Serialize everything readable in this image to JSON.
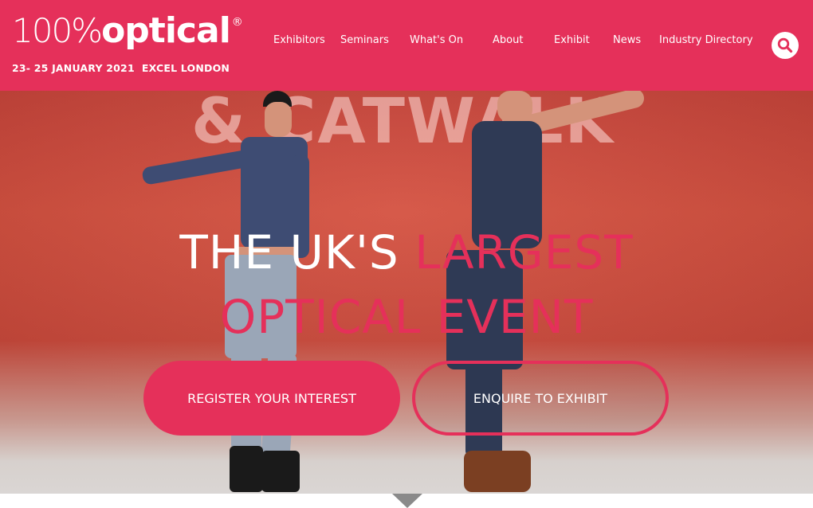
{
  "header": {
    "logo_prefix": "100%",
    "logo_main": "optical",
    "logo_reg": "®",
    "dates": "23- 25 JANUARY 2021",
    "venue": "EXCEL LONDON"
  },
  "nav": {
    "items": [
      {
        "label": "Exhibitors"
      },
      {
        "label": "Seminars"
      },
      {
        "label": "What's On"
      },
      {
        "label": "About"
      },
      {
        "label": "Exhibit"
      },
      {
        "label": "News"
      },
      {
        "label": "Industry Directory"
      }
    ],
    "search_icon": "search-icon"
  },
  "hero": {
    "backdrop_text": "& CATWALK",
    "headline_part1": "THE UK'S",
    "headline_part2": "LARGEST",
    "headline_line2": "OPTICAL EVENT",
    "register_button": "REGISTER YOUR INTEREST",
    "exhibit_button": "ENQUIRE TO EXHIBIT"
  },
  "colors": {
    "brand": "#e5305a",
    "text_on_brand": "#ffffff"
  }
}
